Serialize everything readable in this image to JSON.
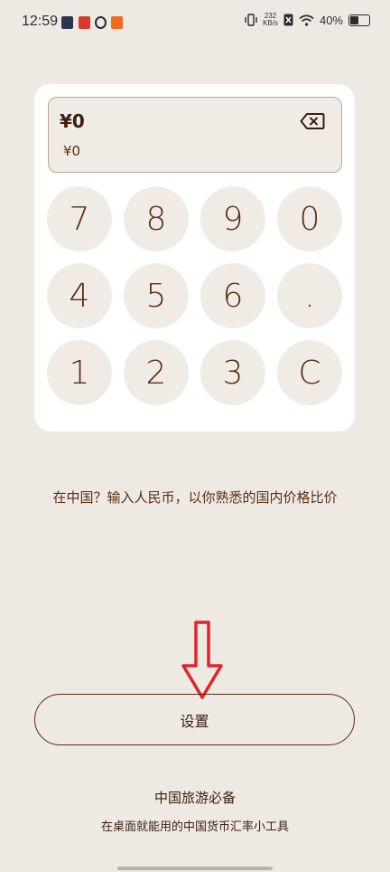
{
  "status_bar": {
    "time": "12:59",
    "network_speed": "232",
    "network_speed_unit": "KB/s",
    "battery": "40%",
    "app_icon_colors": [
      "#2a3550",
      "#d8392f",
      "#2b2b2b",
      "#ef6b1d"
    ]
  },
  "converter": {
    "primary_amount": "¥0",
    "secondary_amount": "¥0",
    "backspace_icon": "backspace-icon",
    "keys": [
      "7",
      "8",
      "9",
      "0",
      "4",
      "5",
      "6",
      ".",
      "1",
      "2",
      "3",
      "C"
    ]
  },
  "hint_text": "在中国？输入人民币，以你熟悉的国内价格比价",
  "settings_label": "设置",
  "footer": {
    "title": "中国旅游必备",
    "subtitle": "在桌面就能用的中国货币汇率小工具"
  },
  "colors": {
    "background": "#efe9e4",
    "accent": "#5a2e14",
    "key_bg": "#f1ebe6",
    "annotation_arrow": "#e0242b"
  }
}
